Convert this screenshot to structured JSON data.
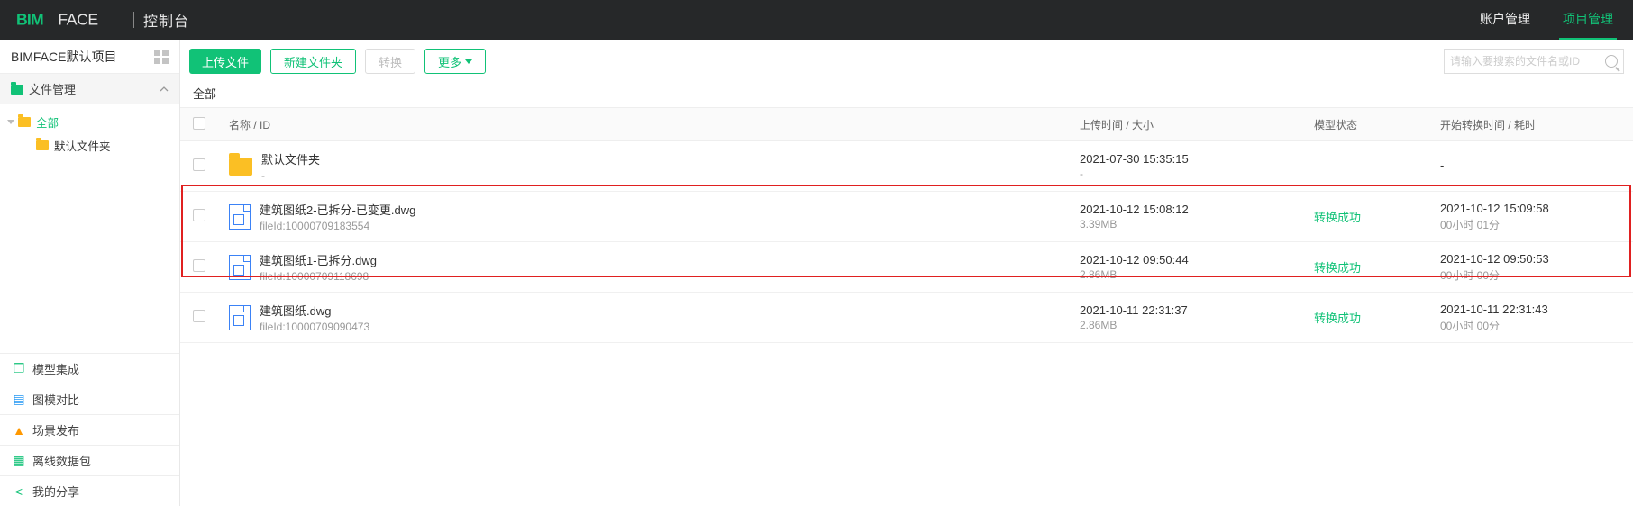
{
  "header": {
    "logo_text": "控制台",
    "nav": {
      "account": "账户管理",
      "project": "项目管理"
    }
  },
  "sidebar": {
    "project_name": "BIMFACE默认项目",
    "file_mgmt": "文件管理",
    "tree_all": "全部",
    "tree_default": "默认文件夹",
    "model_integration": "模型集成",
    "graph_compare": "图模对比",
    "scene_publish": "场景发布",
    "offline_pkg": "离线数据包",
    "my_share": "我的分享"
  },
  "toolbar": {
    "upload": "上传文件",
    "new_folder": "新建文件夹",
    "convert": "转换",
    "more": "更多",
    "search_placeholder": "请输入要搜索的文件名或ID"
  },
  "breadcrumb": "全部",
  "columns": {
    "name": "名称 / ID",
    "time": "上传时间 / 大小",
    "status": "模型状态",
    "conv": "开始转换时间 / 耗时"
  },
  "rows": [
    {
      "type": "folder",
      "name": "默认文件夹",
      "sub": "-",
      "time": "2021-07-30 15:35:15",
      "size": "-",
      "status": "",
      "conv_time": "-",
      "conv_dur": ""
    },
    {
      "type": "file",
      "name": "建筑图纸2-已拆分-已变更.dwg",
      "sub": "fileId:10000709183554",
      "time": "2021-10-12 15:08:12",
      "size": "3.39MB",
      "status": "转换成功",
      "conv_time": "2021-10-12 15:09:58",
      "conv_dur": "00小时 01分"
    },
    {
      "type": "file",
      "name": "建筑图纸1-已拆分.dwg",
      "sub": "fileId:10000709118698",
      "time": "2021-10-12 09:50:44",
      "size": "2.86MB",
      "status": "转换成功",
      "conv_time": "2021-10-12 09:50:53",
      "conv_dur": "00小时 00分"
    },
    {
      "type": "file",
      "name": "建筑图纸.dwg",
      "sub": "fileId:10000709090473",
      "time": "2021-10-11 22:31:37",
      "size": "2.86MB",
      "status": "转换成功",
      "conv_time": "2021-10-11 22:31:43",
      "conv_dur": "00小时 00分"
    }
  ]
}
